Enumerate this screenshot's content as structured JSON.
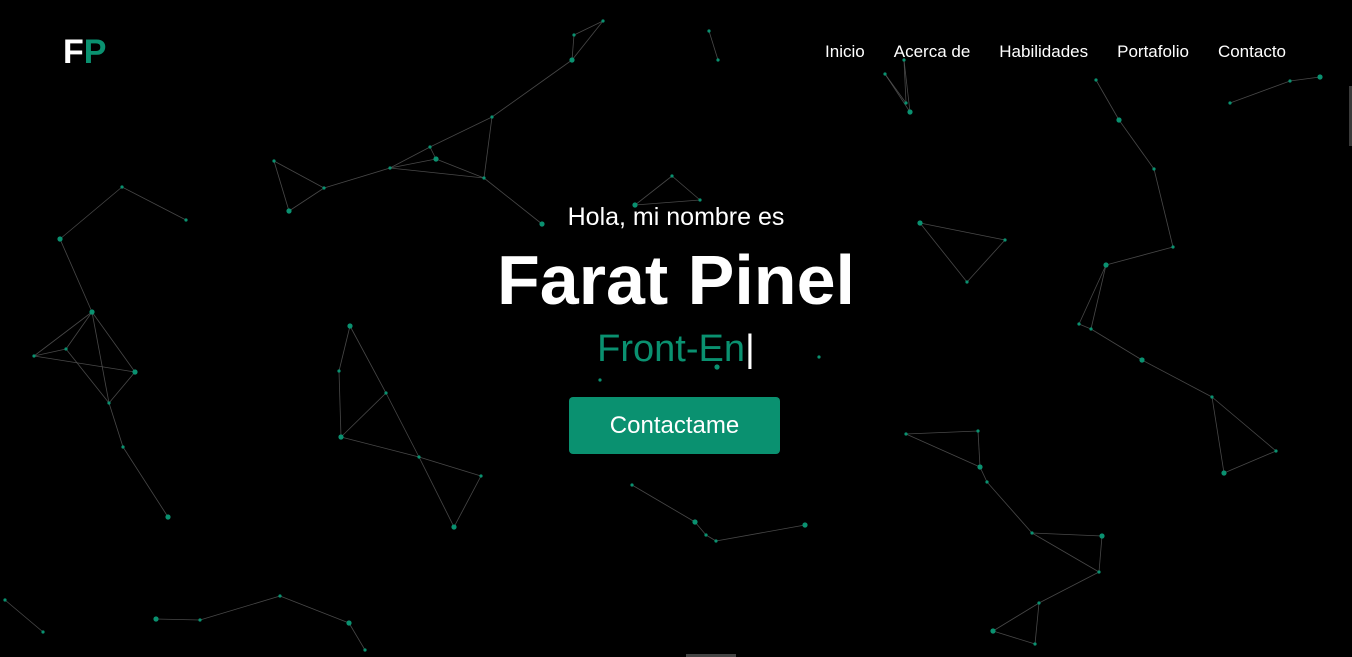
{
  "logo": {
    "first": "F",
    "second": "P"
  },
  "nav": {
    "items": [
      {
        "label": "Inicio"
      },
      {
        "label": "Acerca de"
      },
      {
        "label": "Habilidades"
      },
      {
        "label": "Portafolio"
      },
      {
        "label": "Contacto"
      }
    ]
  },
  "hero": {
    "greeting": "Hola, mi nombre es",
    "name": "Farat Pinel",
    "role": "Front-En",
    "cursor": "|",
    "cta_label": "Contactame"
  },
  "colors": {
    "background": "#000000",
    "accent": "#0a9170",
    "text": "#ffffff",
    "particle_line": "#555555"
  }
}
